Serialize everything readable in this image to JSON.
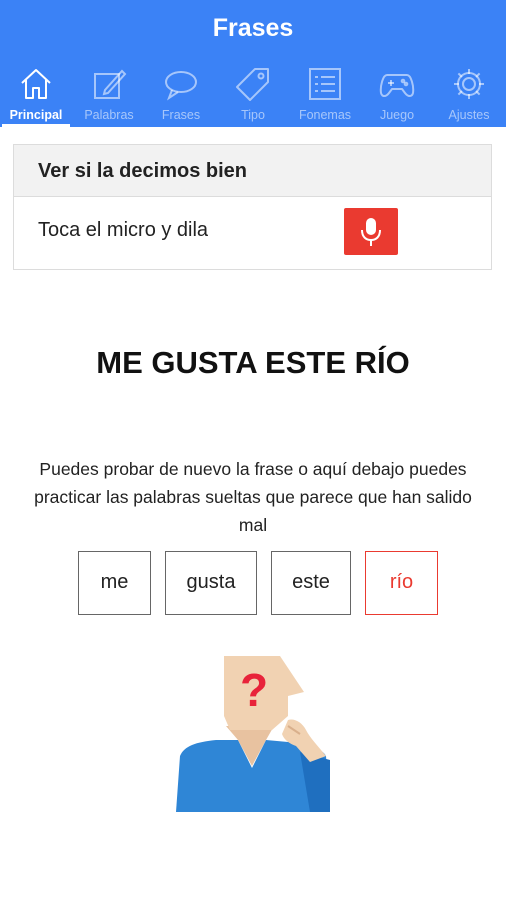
{
  "header": {
    "title": "Frases"
  },
  "tabs": [
    {
      "label": "Principal",
      "icon": "house-icon"
    },
    {
      "label": "Palabras",
      "icon": "pencil-note-icon"
    },
    {
      "label": "Frases",
      "icon": "speech-bubble-icon"
    },
    {
      "label": "Tipo",
      "icon": "tag-icon"
    },
    {
      "label": "Fonemas",
      "icon": "list-icon"
    },
    {
      "label": "Juego",
      "icon": "gamepad-icon"
    },
    {
      "label": "Ajustes",
      "icon": "gear-icon"
    }
  ],
  "active_tab": "Principal",
  "card": {
    "header": "Ver si la decimos bien",
    "prompt": "Toca el micro y dila",
    "mic_icon": "microphone-icon"
  },
  "phrase": "ME GUSTA ESTE RÍO",
  "instructions": "Puedes probar de nuevo la frase o aquí debajo puedes practicar las palabras sueltas que parece que han salido mal",
  "words": [
    {
      "text": "me",
      "status": "ok"
    },
    {
      "text": "gusta",
      "status": "ok"
    },
    {
      "text": "este",
      "status": "ok"
    },
    {
      "text": "río",
      "status": "wrong"
    }
  ],
  "colors": {
    "primary": "#3b82f6",
    "accent_red": "#ea3a30",
    "shirt_blue": "#2f86d6",
    "skin": "#f1d2b2"
  }
}
